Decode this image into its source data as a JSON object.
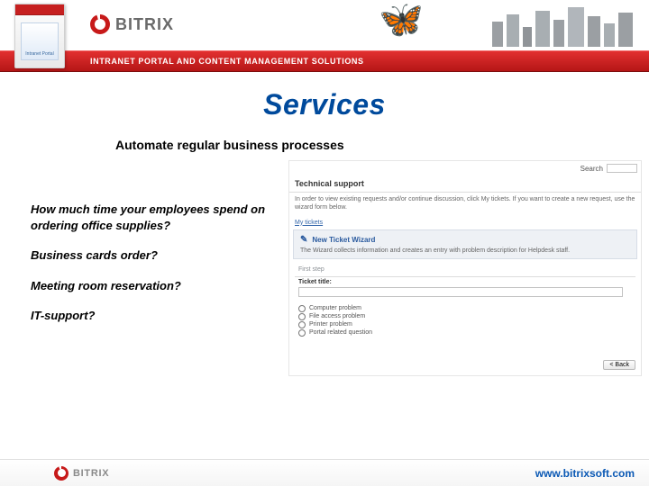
{
  "header": {
    "brand": "BITRIX",
    "tagline": "INTRANET PORTAL AND CONTENT MANAGEMENT SOLUTIONS",
    "productbox_caption": "Intranet Portal"
  },
  "title": "Services",
  "subtitle": "Automate regular business processes",
  "questions": {
    "q1": "How much time your employees spend on ordering office supplies?",
    "q2": "Business cards order?",
    "q3": "Meeting room reservation?",
    "q4": "IT-support?"
  },
  "panel": {
    "search_label": "Search",
    "search_value": "",
    "heading": "Technical support",
    "intro": "In order to view existing requests and/or continue discussion, click My tickets. If you want to create a new request, use the wizard form below.",
    "my_tickets": "My tickets",
    "wizard_title": "New Ticket Wizard",
    "wizard_desc": "The Wizard collects information and creates an entry with problem description for Helpdesk staff.",
    "first_step": "First step",
    "ticket_title_label": "Ticket title:",
    "ticket_title_value": "",
    "radios": {
      "r1": "Computer problem",
      "r2": "File access problem",
      "r3": "Printer problem",
      "r4": "Portal related question"
    },
    "back": "< Back"
  },
  "footer": {
    "brand": "BITRIX",
    "url": "www.bitrixsoft.com"
  }
}
